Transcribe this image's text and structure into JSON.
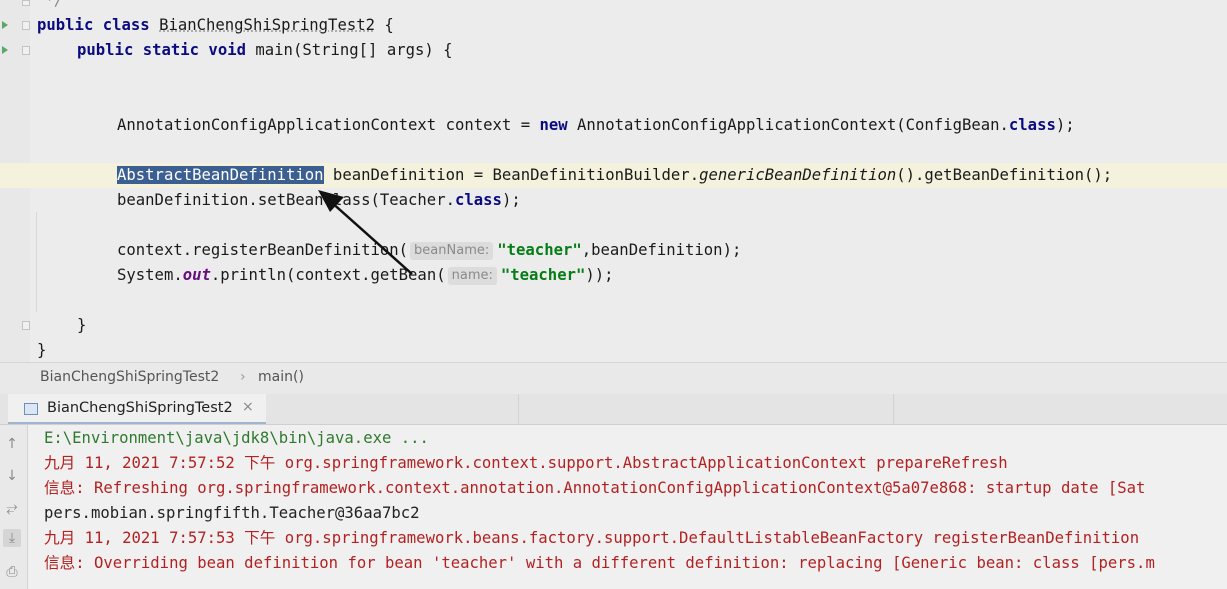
{
  "editor": {
    "comment_end": "*/",
    "class_kw": "public class",
    "class_name": "BianChengShiSpringTest2",
    "class_open": " {",
    "main_kw": "public static void",
    "main_sig": " main(String[] args) {",
    "line_ctx_type": "AnnotationConfigApplicationContext context = ",
    "new_kw": "new",
    "line_ctx_ctor": " AnnotationConfigApplicationContext(ConfigBean.",
    "class_kw2": "class",
    "line_end_paren": ");",
    "selected_token": "AbstractBeanDefinition",
    "line_bd_rest1": " beanDefinition = BeanDefinitionBuilder.",
    "line_bd_method": "genericBeanDefinition",
    "line_bd_rest2": "().getBeanDefinition();",
    "line_set_a": "beanDefinition.setBeanClass(Teacher.",
    "line_set_class": "class",
    "line_set_end": ");",
    "line_reg_a": "context.registerBeanDefinition(",
    "hint_beanName": "beanName:",
    "str_teacher": "\"teacher\"",
    "line_reg_b": ",beanDefinition);",
    "line_print_a": "System.",
    "field_out": "out",
    "line_print_b": ".println(context.getBean(",
    "hint_name": "name:",
    "line_print_c": "));",
    "close_method": "}",
    "close_class": "}"
  },
  "breadcrumb": {
    "class_label": "BianChengShiSpringTest2",
    "separator": "›",
    "method_label": "main()"
  },
  "run_tab": {
    "label": "BianChengShiSpringTest2",
    "close": "×"
  },
  "console": {
    "lines": [
      "E:\\Environment\\java\\jdk8\\bin\\java.exe ...",
      "九月 11, 2021 7:57:52 下午 org.springframework.context.support.AbstractApplicationContext prepareRefresh",
      "信息: Refreshing org.springframework.context.annotation.AnnotationConfigApplicationContext@5a07e868: startup date [Sat",
      "pers.mobian.springfifth.Teacher@36aa7bc2",
      "九月 11, 2021 7:57:53 下午 org.springframework.beans.factory.support.DefaultListableBeanFactory registerBeanDefinition",
      "信息: Overriding bean definition for bean 'teacher' with a different definition: replacing [Generic bean: class [pers.m"
    ]
  },
  "icons": {
    "up": "↑",
    "down": "↓",
    "wrap": "⥂",
    "scroll_end": "⤓",
    "print": "⎙"
  },
  "colors": {
    "keyword": "#0b0b80",
    "string": "#067d17",
    "selection": "#3c5f91",
    "console_error": "#b22222",
    "console_cmd": "#2f7a2f"
  }
}
